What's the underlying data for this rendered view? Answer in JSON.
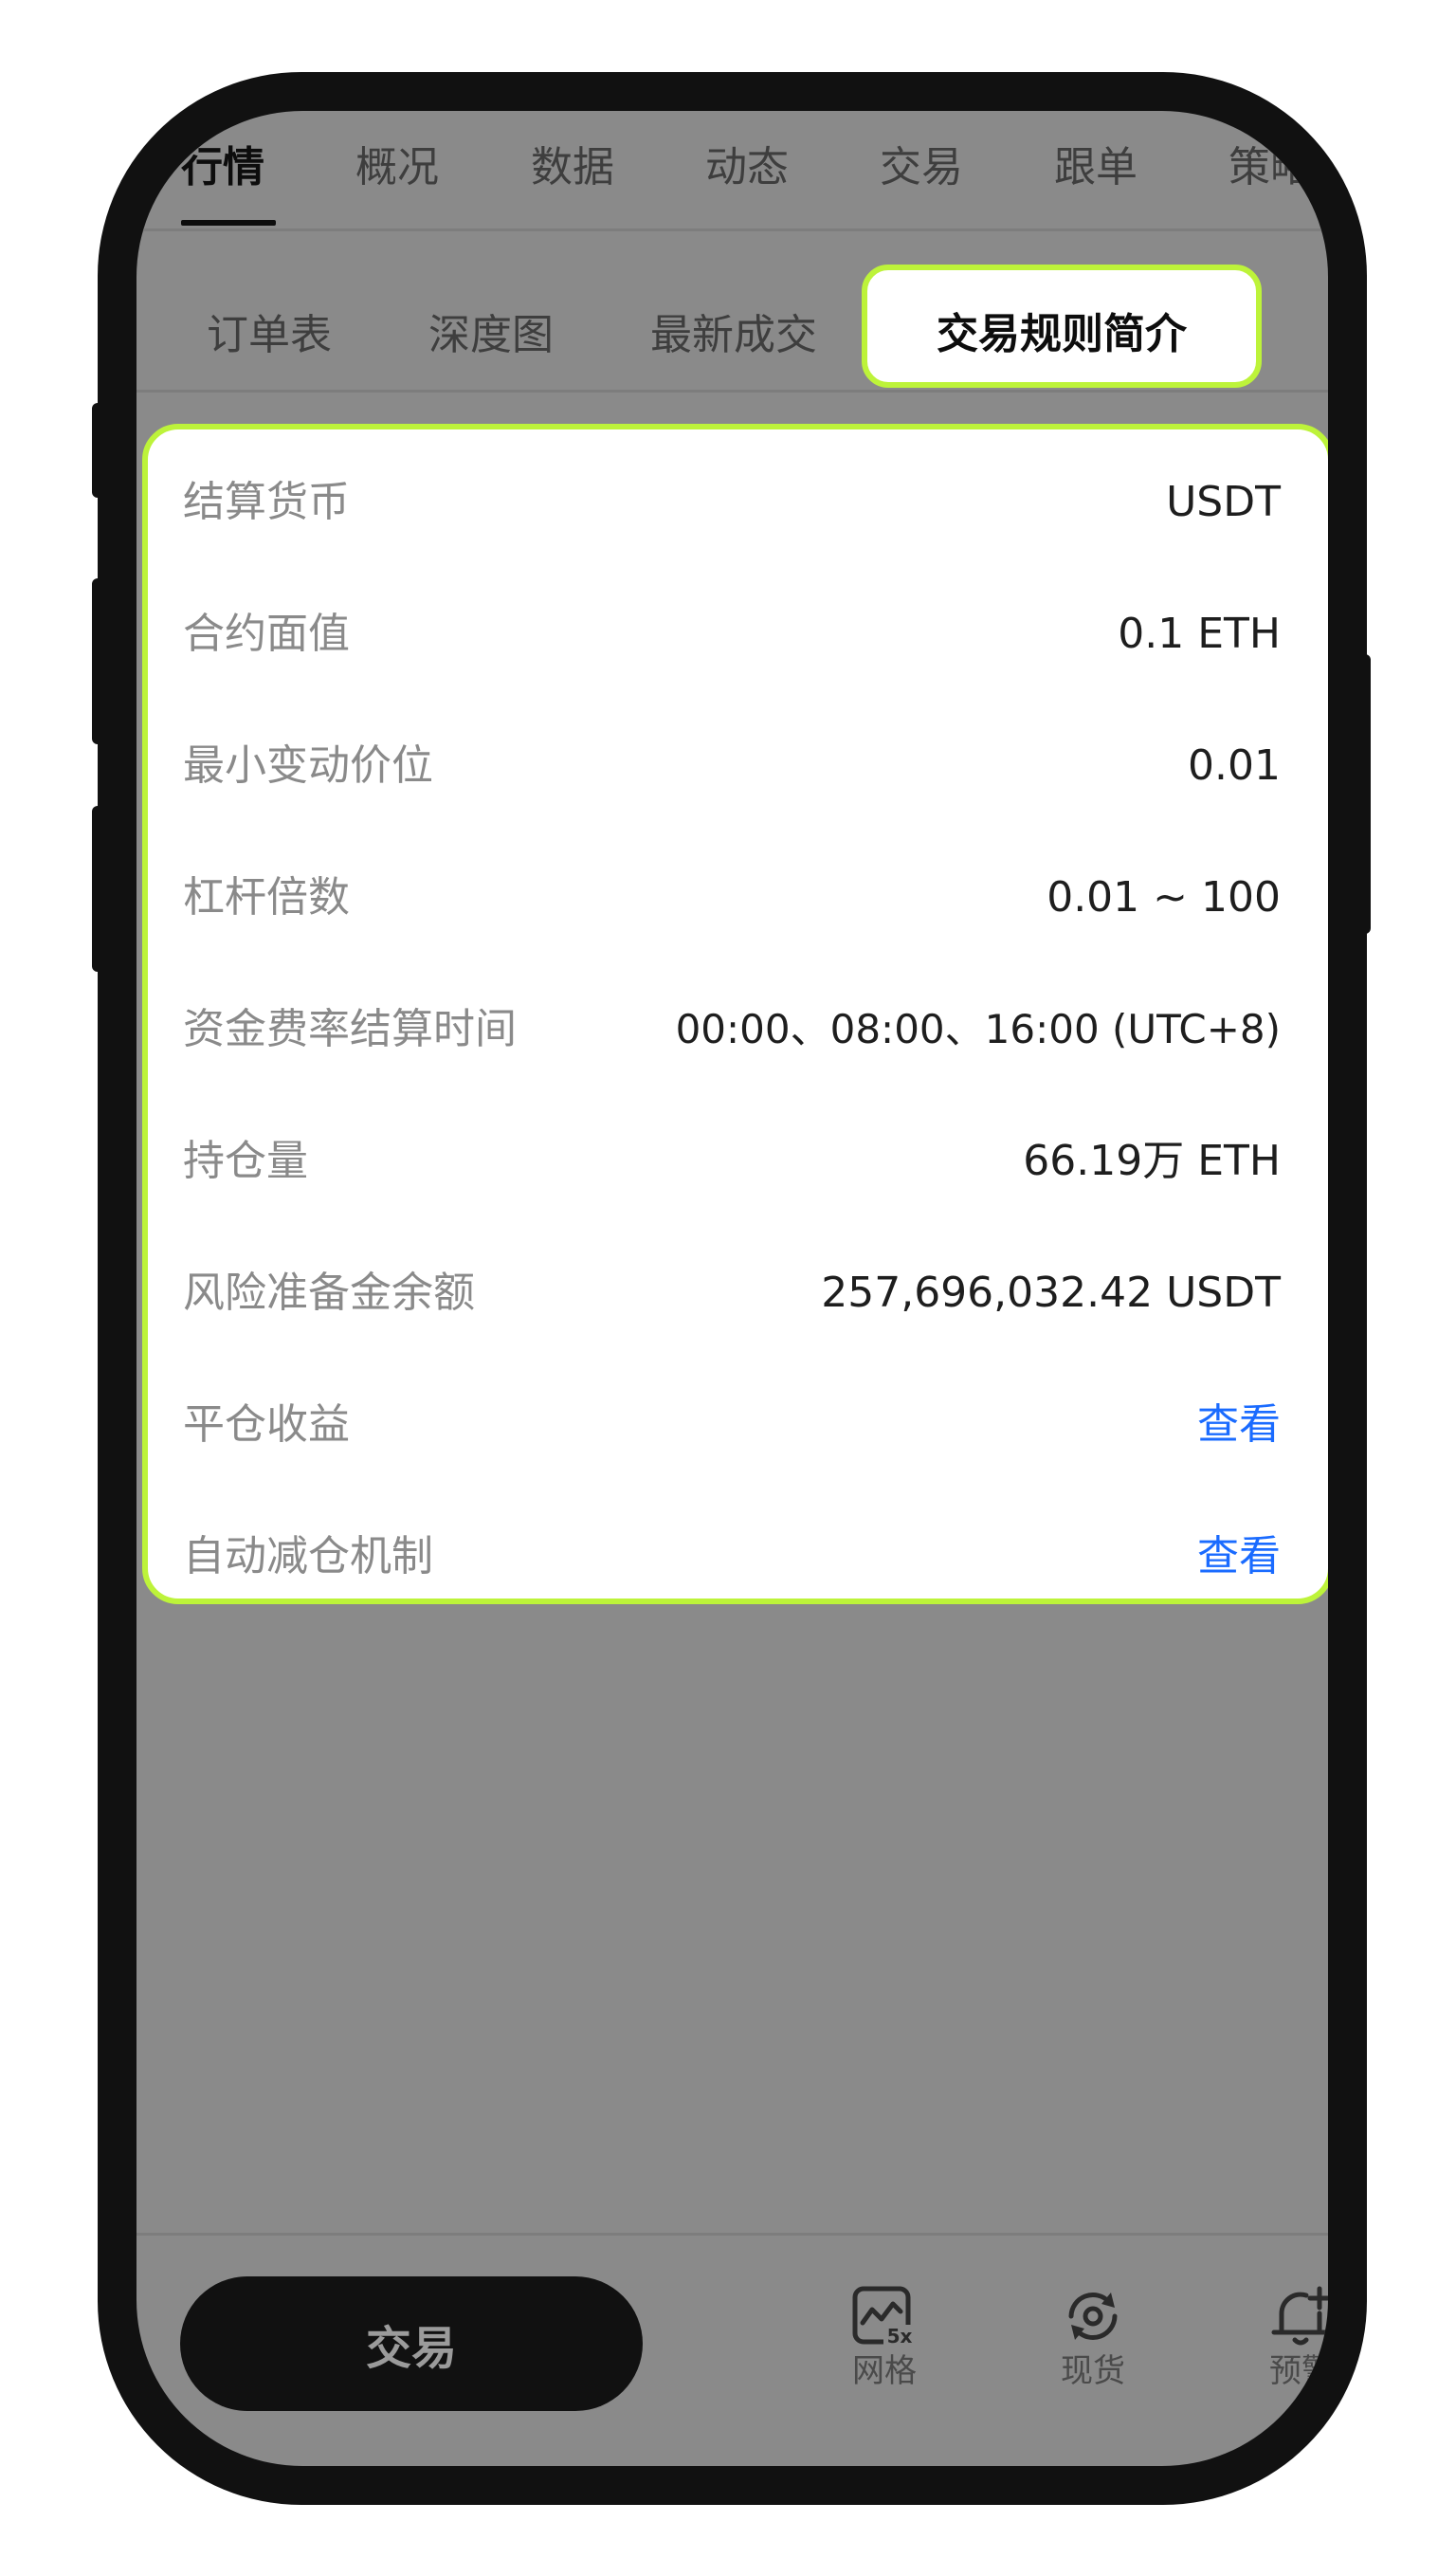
{
  "top_tabs": [
    "行情",
    "概况",
    "数据",
    "动态",
    "交易",
    "跟单",
    "策略"
  ],
  "sub_tabs": [
    "订单表",
    "深度图",
    "最新成交",
    "交易规则简介"
  ],
  "rules": [
    {
      "label": "结算货币",
      "value": "USDT"
    },
    {
      "label": "合约面值",
      "value": "0.1 ETH"
    },
    {
      "label": "最小变动价位",
      "value": "0.01"
    },
    {
      "label": "杠杆倍数",
      "value": "0.01 ~ 100"
    },
    {
      "label": "资金费率结算时间",
      "value": "00:00、08:00、16:00 (UTC+8)"
    },
    {
      "label": "持仓量",
      "value": "66.19万 ETH"
    },
    {
      "label": "风险准备金余额",
      "value": "257,696,032.42 USDT"
    },
    {
      "label": "平仓收益",
      "value": "查看"
    },
    {
      "label": "自动减仓机制",
      "value": "查看"
    }
  ],
  "bottom_bar": {
    "trade_label": "交易",
    "nav": [
      {
        "label": "网格",
        "icon": "grid-bot-icon",
        "badge": "5x"
      },
      {
        "label": "现货",
        "icon": "spot-icon"
      },
      {
        "label": "预警",
        "icon": "alert-bell-icon"
      }
    ]
  },
  "colors": {
    "highlight": "#bdf33a",
    "link": "#1a6bff",
    "overlay": "#8a8a8a",
    "frame": "#111111"
  }
}
